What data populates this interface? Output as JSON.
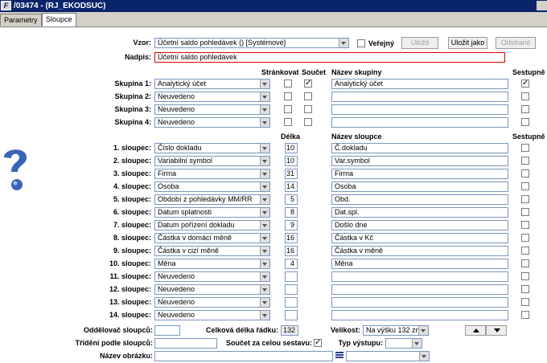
{
  "window": {
    "title": "/03474 - (RJ_EKODSUC)",
    "icon_letter": "F"
  },
  "tabs": [
    {
      "label": "Parametry"
    },
    {
      "label": "Sloupce"
    }
  ],
  "vzor": {
    "label": "Vzor:",
    "value": "Účetní saldo pohledávek   ()   [Systémové]",
    "verejny_label": "Veřejný"
  },
  "buttons": {
    "ulozit": "Uložit",
    "ulozit_jako": "Uložit jako",
    "odstranit": "Odstranit"
  },
  "nadpis": {
    "label": "Nadpis:",
    "value": "Účetní saldo pohledávek"
  },
  "group_headers": {
    "strankovat": "Stránkovat",
    "soucet": "Součet",
    "nazev_skupiny": "Název skupiny",
    "sestupne": "Sestupně"
  },
  "groups": [
    {
      "label": "Skupina 1:",
      "value": "Analytický účet",
      "strankovat": false,
      "soucet": true,
      "name": "Analytický účet",
      "sestupne": true
    },
    {
      "label": "Skupina 2:",
      "value": "Neuvedeno",
      "strankovat": false,
      "soucet": false,
      "name": "",
      "sestupne": false
    },
    {
      "label": "Skupina 3:",
      "value": "Neuvedeno",
      "strankovat": false,
      "soucet": false,
      "name": "",
      "sestupne": false
    },
    {
      "label": "Skupina 4:",
      "value": "Neuvedeno",
      "strankovat": false,
      "soucet": false,
      "name": "",
      "sestupne": false
    }
  ],
  "column_headers": {
    "delka": "Délka",
    "nazev_sloupce": "Název sloupce",
    "sestupne": "Sestupně"
  },
  "columns": [
    {
      "label": "1. sloupec:",
      "value": "Číslo dokladu",
      "delka": "10",
      "name": "Č.dokladu",
      "sestupne": false
    },
    {
      "label": "2. sloupec:",
      "value": "Variabilní symbol",
      "delka": "10",
      "name": "Var.symbol",
      "sestupne": false
    },
    {
      "label": "3. sloupec:",
      "value": "Firma",
      "delka": "31",
      "name": "Firma",
      "sestupne": false
    },
    {
      "label": "4. sloupec:",
      "value": "Osoba",
      "delka": "14",
      "name": "Osoba",
      "sestupne": false
    },
    {
      "label": "5. sloupec:",
      "value": "Období z pohledávky MM/RR",
      "delka": "5",
      "name": "Obd.",
      "sestupne": false
    },
    {
      "label": "6. sloupec:",
      "value": "Datum splatnosti",
      "delka": "8",
      "name": "Dat.spl.",
      "sestupne": false
    },
    {
      "label": "7. sloupec:",
      "value": "Datum pořízení dokladu",
      "delka": "9",
      "name": "Došlo dne",
      "sestupne": false
    },
    {
      "label": "8. sloupec:",
      "value": "Částka v domácí měně",
      "delka": "16",
      "name": "Částka v Kč",
      "sestupne": false
    },
    {
      "label": "9. sloupec:",
      "value": "Částka v cizí měně",
      "delka": "16",
      "name": "Částka v měně",
      "sestupne": false
    },
    {
      "label": "10. sloupec:",
      "value": "Měna",
      "delka": "4",
      "name": "Měna",
      "sestupne": false
    },
    {
      "label": "11. sloupec:",
      "value": "Neuvedeno",
      "delka": "",
      "name": "",
      "sestupne": false
    },
    {
      "label": "12. sloupec:",
      "value": "Neuvedeno",
      "delka": "",
      "name": "",
      "sestupne": false
    },
    {
      "label": "13. sloupec:",
      "value": "Neuvedeno",
      "delka": "",
      "name": "",
      "sestupne": false
    },
    {
      "label": "14. sloupec:",
      "value": "Neuvedeno",
      "delka": "",
      "name": "",
      "sestupne": false
    }
  ],
  "footer": {
    "oddelovac_label": "Oddělovač sloupců:",
    "oddelovac_value": "",
    "celkova_label": "Celková délka řádku:",
    "celkova_value": "132",
    "velikost_label": "Velikost:",
    "velikost_value": "Na výšku 132 zn.",
    "trideni_label": "Třídění podle sloupců:",
    "trideni_value": "",
    "soucet_label": "Součet za celou sestavu:",
    "soucet_checked": true,
    "typ_label": "Typ výstupu:",
    "typ_value": "",
    "obrazek_label": "Název obrázku:",
    "obrazek_value": ""
  },
  "colors": {
    "titlebar": "#0a246a",
    "field_border": "#7a96c0",
    "nadpis_border": "#e00000",
    "help_icon": "#3a64b8"
  }
}
